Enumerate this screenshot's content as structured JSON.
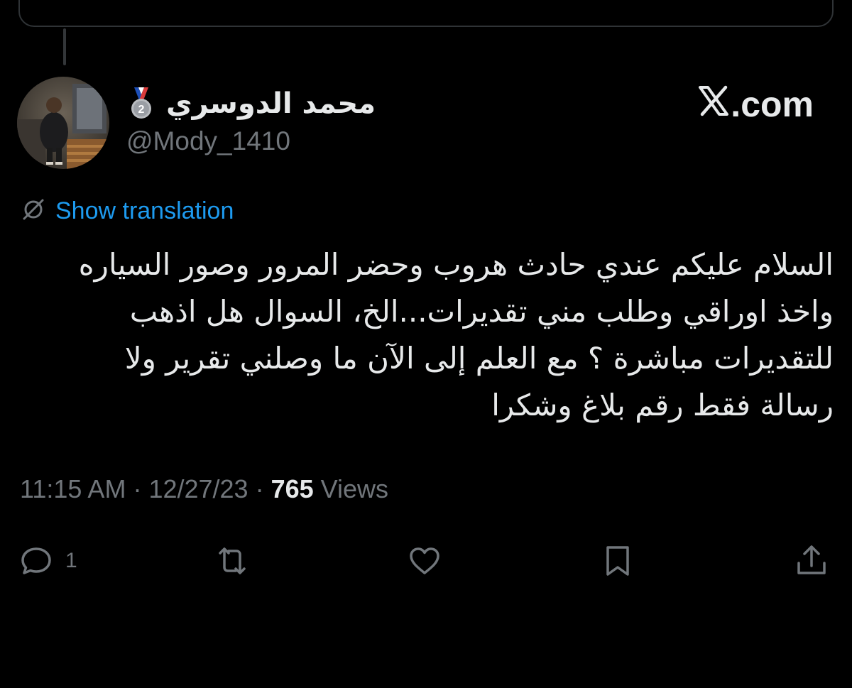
{
  "author": {
    "display_name": "محمد الدوسري",
    "handle": "@Mody_1410",
    "badge_icon": "second-place-medal-icon",
    "medal_number": "2"
  },
  "brand": {
    "label": ".com",
    "icon": "x-logo-icon"
  },
  "translation": {
    "label": "Show translation",
    "icon": "globe-slash-icon"
  },
  "tweet": {
    "lines": [
      "السلام عليكم عندي حادث هروب وحضر المرور وصور السياره",
      "واخذ اوراقي وطلب مني تقديرات...الخ، السوال هل اذهب",
      "للتقديرات مباشرة ؟ مع العلم إلى الآن ما وصلني تقرير ولا",
      "رسالة فقط رقم بلاغ وشكرا"
    ]
  },
  "meta": {
    "time": "11:15 AM",
    "separator": "·",
    "date": "12/27/23",
    "views_count": "765",
    "views_label": "Views"
  },
  "actions": {
    "reply_count": "1"
  },
  "colors": {
    "background": "#000000",
    "text": "#e7e9ea",
    "muted": "#71767b",
    "link": "#1d9bf0",
    "border": "#2f3336"
  }
}
